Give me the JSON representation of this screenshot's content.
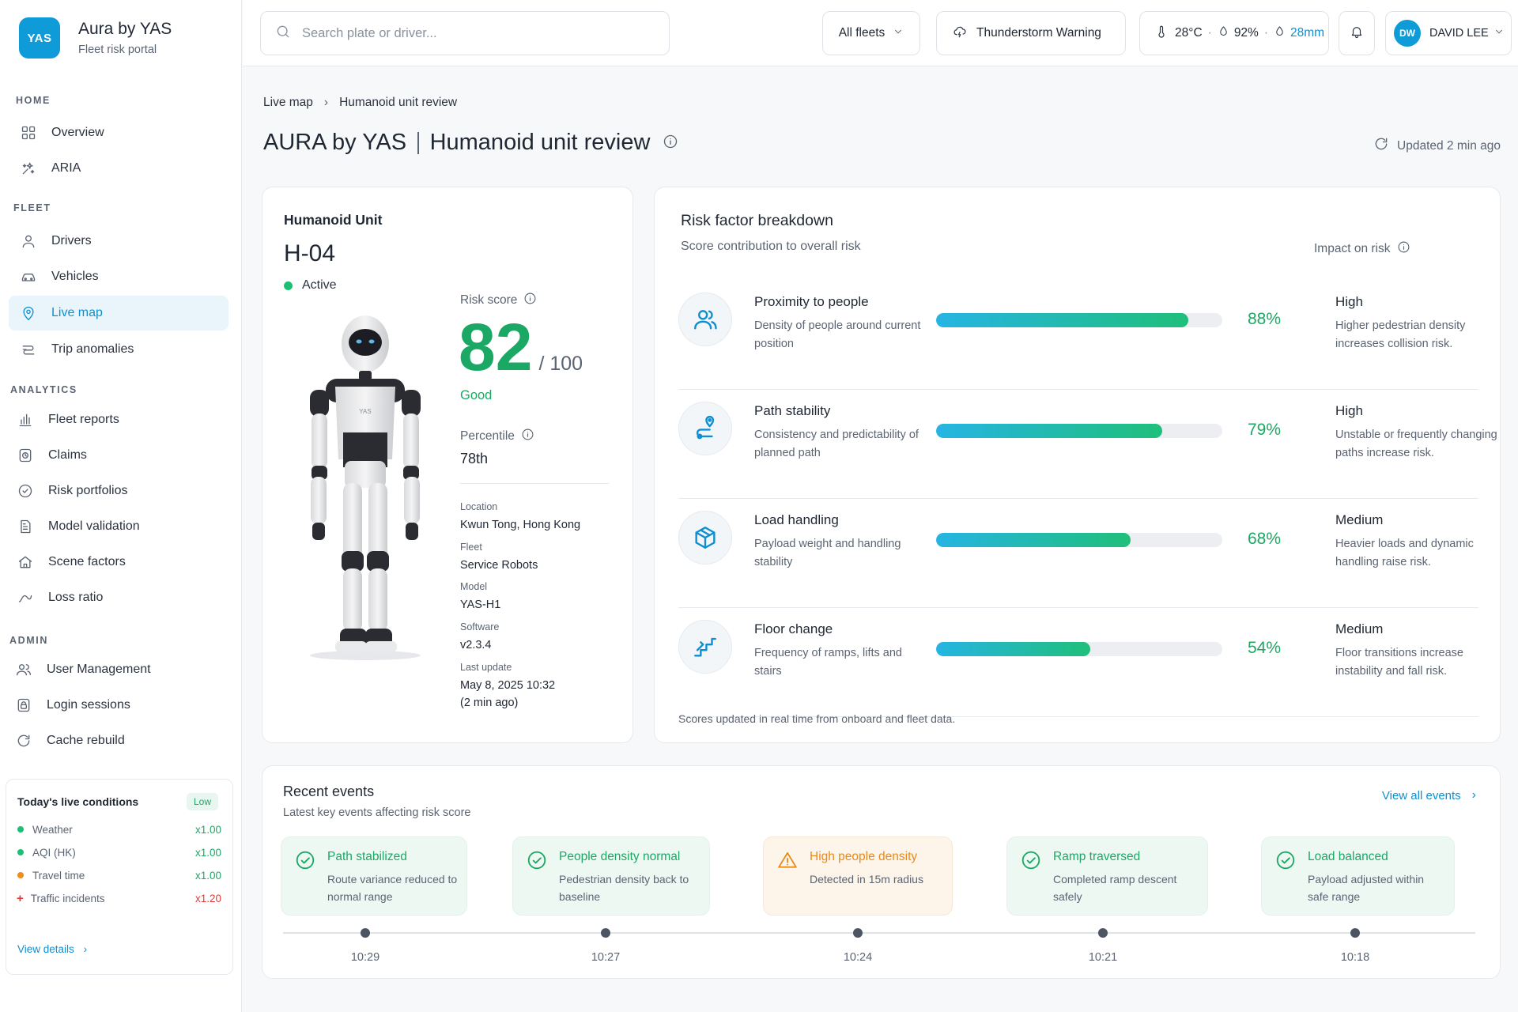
{
  "brand": {
    "logo": "YAS",
    "name": "Aura by YAS",
    "subtitle": "Fleet risk portal"
  },
  "sidebar": {
    "sections": [
      {
        "heading": "HOME",
        "items": [
          {
            "label": "Overview",
            "icon": "grid-icon"
          },
          {
            "label": "ARIA",
            "icon": "sparkle-icon"
          }
        ]
      },
      {
        "heading": "FLEET",
        "items": [
          {
            "label": "Drivers",
            "icon": "user-icon"
          },
          {
            "label": "Vehicles",
            "icon": "car-icon"
          },
          {
            "label": "Live map",
            "icon": "map-pin-icon",
            "active": true
          },
          {
            "label": "Trip anomalies",
            "icon": "route-icon"
          }
        ]
      },
      {
        "heading": "ANALYTICS",
        "items": [
          {
            "label": "Fleet reports",
            "icon": "bar-chart-icon"
          },
          {
            "label": "Claims",
            "icon": "clock-file-icon"
          },
          {
            "label": "Risk portfolios",
            "icon": "shield-check-icon"
          },
          {
            "label": "Model validation",
            "icon": "document-icon"
          },
          {
            "label": "Scene factors",
            "icon": "home-icon"
          },
          {
            "label": "Loss ratio",
            "icon": "trend-icon"
          }
        ]
      },
      {
        "heading": "ADMIN",
        "items": [
          {
            "label": "User Management",
            "icon": "users-icon"
          },
          {
            "label": "Login sessions",
            "icon": "session-icon"
          },
          {
            "label": "Cache rebuild",
            "icon": "refresh-icon"
          }
        ]
      }
    ],
    "conditions": {
      "title": "Today's live conditions",
      "badge": "Low",
      "rows": [
        {
          "label": "Weather",
          "value": "x1.00",
          "color": "#1dbf73"
        },
        {
          "label": "AQI (HK)",
          "value": "x1.00",
          "color": "#1dbf73"
        },
        {
          "label": "Travel time",
          "value": "x1.00",
          "color": "#f08c1a"
        },
        {
          "label": "Traffic incidents",
          "value": "x1.20",
          "color": "#e53935"
        }
      ],
      "link": "View details"
    }
  },
  "topbar": {
    "search_placeholder": "Search plate or driver...",
    "fleet_filter": "All fleets",
    "alert": "Thunderstorm Warning",
    "weather": {
      "temp": "28°C",
      "humidity": "92%",
      "rain": "28mm"
    },
    "user": {
      "initials": "DW",
      "name": "DAVID LEE"
    }
  },
  "page": {
    "breadcrumb": [
      "Live map",
      "Humanoid unit review"
    ],
    "title_brand": "AURA by YAS",
    "title": "Humanoid unit review",
    "updated": "Updated 2 min ago"
  },
  "unit": {
    "label": "Humanoid Unit",
    "id": "H-04",
    "status": "Active",
    "robot_mark": "YAS",
    "risk_score_label": "Risk score",
    "risk_score": "82",
    "risk_score_max": "/ 100",
    "risk_score_word": "Good",
    "percentile_label": "Percentile",
    "percentile": "78th",
    "meta": [
      {
        "k": "Location",
        "v": "Kwun Tong, Hong Kong"
      },
      {
        "k": "Fleet",
        "v": "Service Robots"
      },
      {
        "k": "Model",
        "v": "YAS-H1"
      },
      {
        "k": "Software",
        "v": "v2.3.4"
      },
      {
        "k": "Last update",
        "v": "May 8, 2025 10:32",
        "v2": "(2 min ago)"
      }
    ]
  },
  "risk": {
    "title": "Risk factor breakdown",
    "subtitle": "Score contribution to overall risk",
    "impact_header": "Impact on risk",
    "factors": [
      {
        "name": "Proximity to people",
        "desc": "Density of people around current position",
        "pct": 88,
        "pct_label": "88%",
        "level": "High",
        "note": "Higher pedestrian density increases collision risk.",
        "icon": "people-icon"
      },
      {
        "name": "Path stability",
        "desc": "Consistency and predictability of planned path",
        "pct": 79,
        "pct_label": "79%",
        "level": "High",
        "note": "Unstable or frequently changing paths increase risk.",
        "icon": "path-icon"
      },
      {
        "name": "Load handling",
        "desc": "Payload weight and handling stability",
        "pct": 68,
        "pct_label": "68%",
        "level": "Medium",
        "note": "Heavier loads and dynamic handling raise risk.",
        "icon": "box-icon"
      },
      {
        "name": "Floor change",
        "desc": "Frequency of ramps, lifts and stairs",
        "pct": 54,
        "pct_label": "54%",
        "level": "Medium",
        "note": "Floor transitions increase instability and fall risk.",
        "icon": "stairs-icon"
      }
    ],
    "footer": "Scores updated in real time from onboard and fleet data."
  },
  "events": {
    "title": "Recent events",
    "subtitle": "Latest key events affecting risk score",
    "link": "View all events",
    "items": [
      {
        "name": "Path stabilized",
        "desc": "Route variance reduced to normal range",
        "time": "10:29",
        "type": "ok"
      },
      {
        "name": "People density normal",
        "desc": "Pedestrian density back to baseline",
        "time": "10:27",
        "type": "ok"
      },
      {
        "name": "High people density",
        "desc": "Detected in 15m radius",
        "time": "10:24",
        "type": "warn"
      },
      {
        "name": "Ramp traversed",
        "desc": "Completed ramp descent safely",
        "time": "10:21",
        "type": "ok"
      },
      {
        "name": "Load balanced",
        "desc": "Payload adjusted within safe range",
        "time": "10:18",
        "type": "ok"
      }
    ]
  },
  "colors": {
    "accent": "#0f9bd7",
    "good": "#1aa864",
    "warn": "#e88a1a",
    "danger": "#e53935"
  }
}
